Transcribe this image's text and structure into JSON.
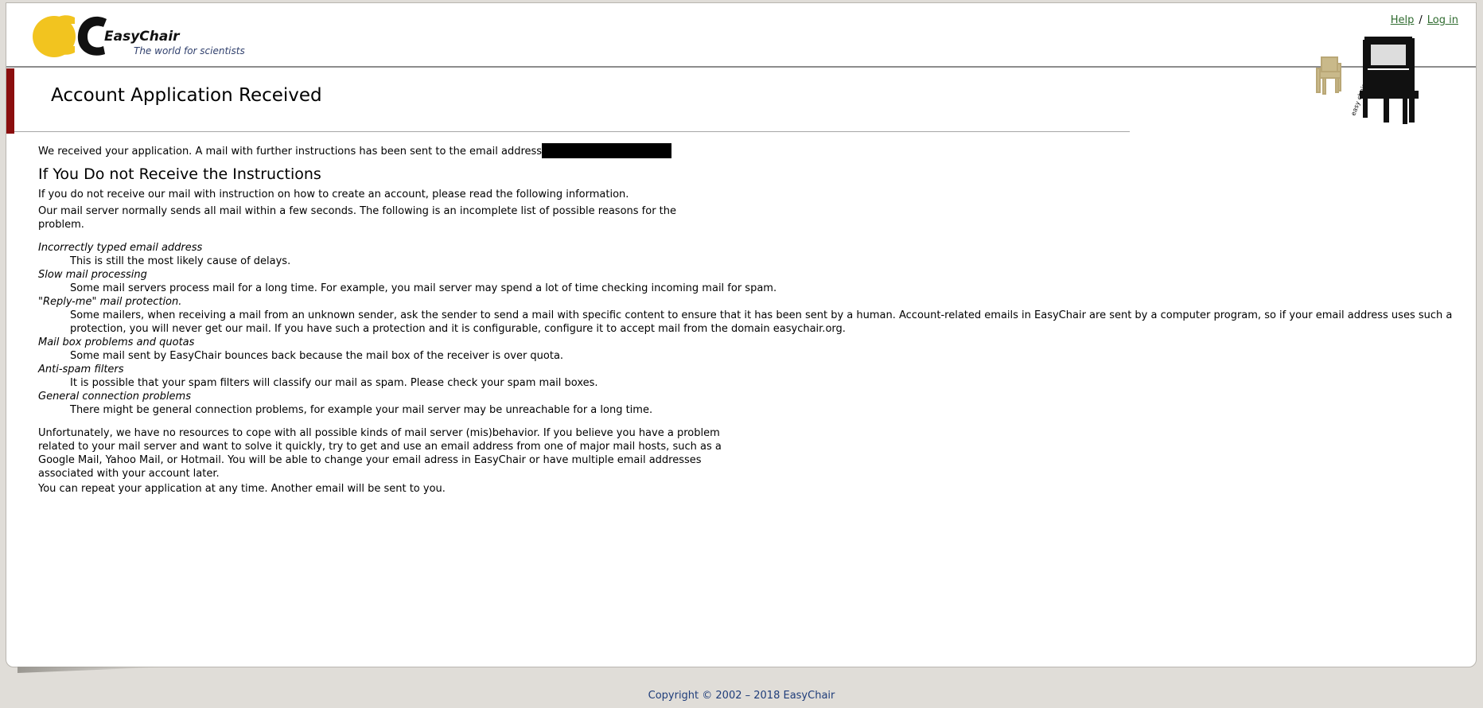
{
  "header": {
    "brand_name": "EasyChair",
    "tagline": "The world for scientists",
    "help_link": "Help",
    "separator": "/",
    "login_link": "Log in"
  },
  "title": "Account Application Received",
  "received": {
    "text": "We received your application. A mail with further instructions has been sent to the email address"
  },
  "section_heading": "If You Do not Receive the Instructions",
  "intro": "If you do not receive our mail with instruction on how to create an account, please read the following information.",
  "server_note": "Our mail server normally sends all mail within a few seconds. The following is an incomplete list of possible reasons for the problem.",
  "reasons": [
    {
      "term": "Incorrectly typed email address",
      "desc": "This is still the most likely cause of delays."
    },
    {
      "term": "Slow mail processing",
      "desc": "Some mail servers process mail for a long time. For example, you mail server may spend a lot of time checking incoming mail for spam."
    },
    {
      "term": "\"Reply-me\" mail protection.",
      "desc": "Some mailers, when receiving a mail from an unknown sender, ask the sender to send a mail with specific content to ensure that it has been sent by a human. Account-related emails in EasyChair are sent by a computer program, so if your email address uses such a protection, you will never get our mail. If you have such a protection and it is configurable, configure it to accept mail from the domain easychair.org."
    },
    {
      "term": "Mail box problems and quotas",
      "desc": "Some mail sent by EasyChair bounces back because the mail box of the receiver is over quota."
    },
    {
      "term": "Anti-spam filters",
      "desc": "It is possible that your spam filters will classify our mail as spam. Please check your spam mail boxes."
    },
    {
      "term": "General connection problems",
      "desc": "There might be general connection problems, for example your mail server may be unreachable for a long time."
    }
  ],
  "unfortunately": "Unfortunately, we have no resources to cope with all possible kinds of mail server (mis)behavior. If you believe you have a problem related to your mail server and want to solve it quickly, try to get and use an email address from one of major mail hosts, such as a Google Mail, Yahoo Mail, or Hotmail. You will be able to change your email adress in EasyChair or have multiple email addresses associated with your account later.",
  "repeat": "You can repeat your application at any time. Another email will be sent to you.",
  "footer": "Copyright © 2002 – 2018 EasyChair",
  "colors": {
    "accent_red": "#8b0e0e",
    "link_green": "#2f6b2f",
    "footer_blue": "#1f3d7a",
    "logo_yellow": "#f2c41f"
  }
}
